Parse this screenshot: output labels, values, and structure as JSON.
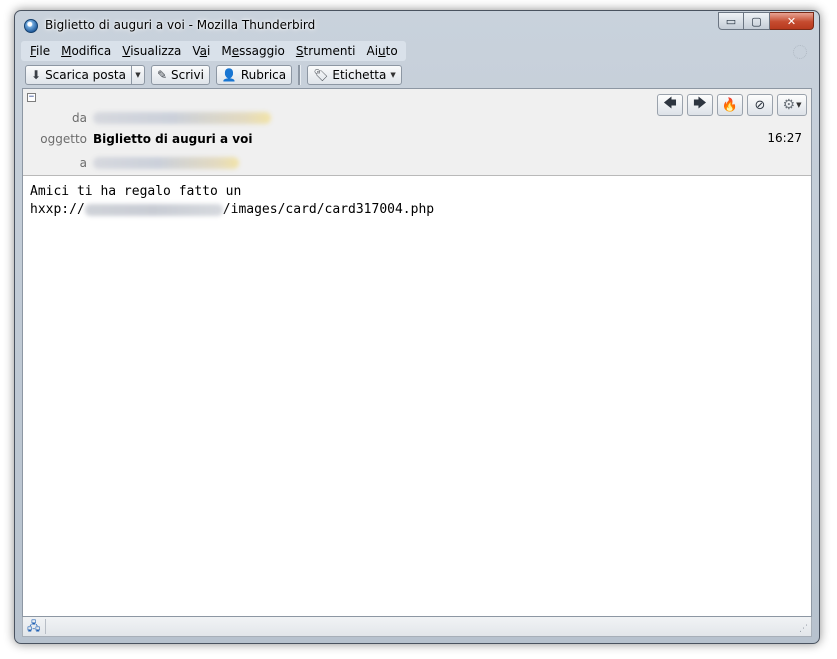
{
  "window": {
    "title": "Biglietto di auguri a voi - Mozilla Thunderbird",
    "controls": {
      "minimize": "▭",
      "maximize": "▢",
      "close": "✕"
    }
  },
  "menubar": {
    "items": [
      {
        "label": "File",
        "u": "F",
        "rest": "ile"
      },
      {
        "label": "Modifica",
        "u": "M",
        "rest": "odifica"
      },
      {
        "label": "Visualizza",
        "u": "V",
        "rest": "isualizza"
      },
      {
        "label": "Vai",
        "pre": "V",
        "u": "a",
        "rest": "i"
      },
      {
        "label": "Messaggio",
        "pre": "M",
        "u": "e",
        "rest": "ssaggio"
      },
      {
        "label": "Strumenti",
        "u": "S",
        "rest": "trumenti"
      },
      {
        "label": "Aiuto",
        "pre": "Ai",
        "u": "u",
        "rest": "to"
      }
    ]
  },
  "toolbar": {
    "get_mail": "Scarica posta",
    "write": "Scrivi",
    "address_book": "Rubrica",
    "tag": "Etichetta"
  },
  "header": {
    "from_label": "da",
    "subject_label": "oggetto",
    "subject": "Biglietto di auguri a voi",
    "to_label": "a",
    "time": "16:27"
  },
  "message": {
    "line1": "Amici ti ha regalo fatto un",
    "url_prefix": "hxxp://",
    "url_suffix": "/images/card/card317004.php"
  },
  "icons": {
    "reply": "reply-icon",
    "forward": "forward-icon",
    "junk": "junk-icon",
    "delete": "delete-icon",
    "gear": "gear-icon",
    "status": "online-status-icon"
  }
}
